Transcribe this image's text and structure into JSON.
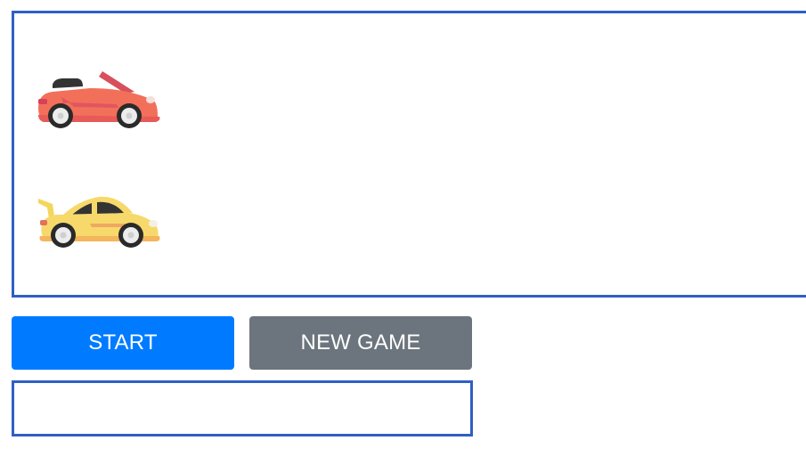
{
  "game": {
    "track": {
      "cars": [
        {
          "name": "red-convertible-car",
          "color": "#f2705a"
        },
        {
          "name": "yellow-sports-car",
          "color": "#f7d96b"
        }
      ]
    },
    "controls": {
      "start_label": "START",
      "new_game_label": "NEW GAME"
    },
    "result_text": ""
  },
  "colors": {
    "track_border": "#2f5fc3",
    "start_button": "#007bff",
    "new_game_button": "#6c757d"
  }
}
